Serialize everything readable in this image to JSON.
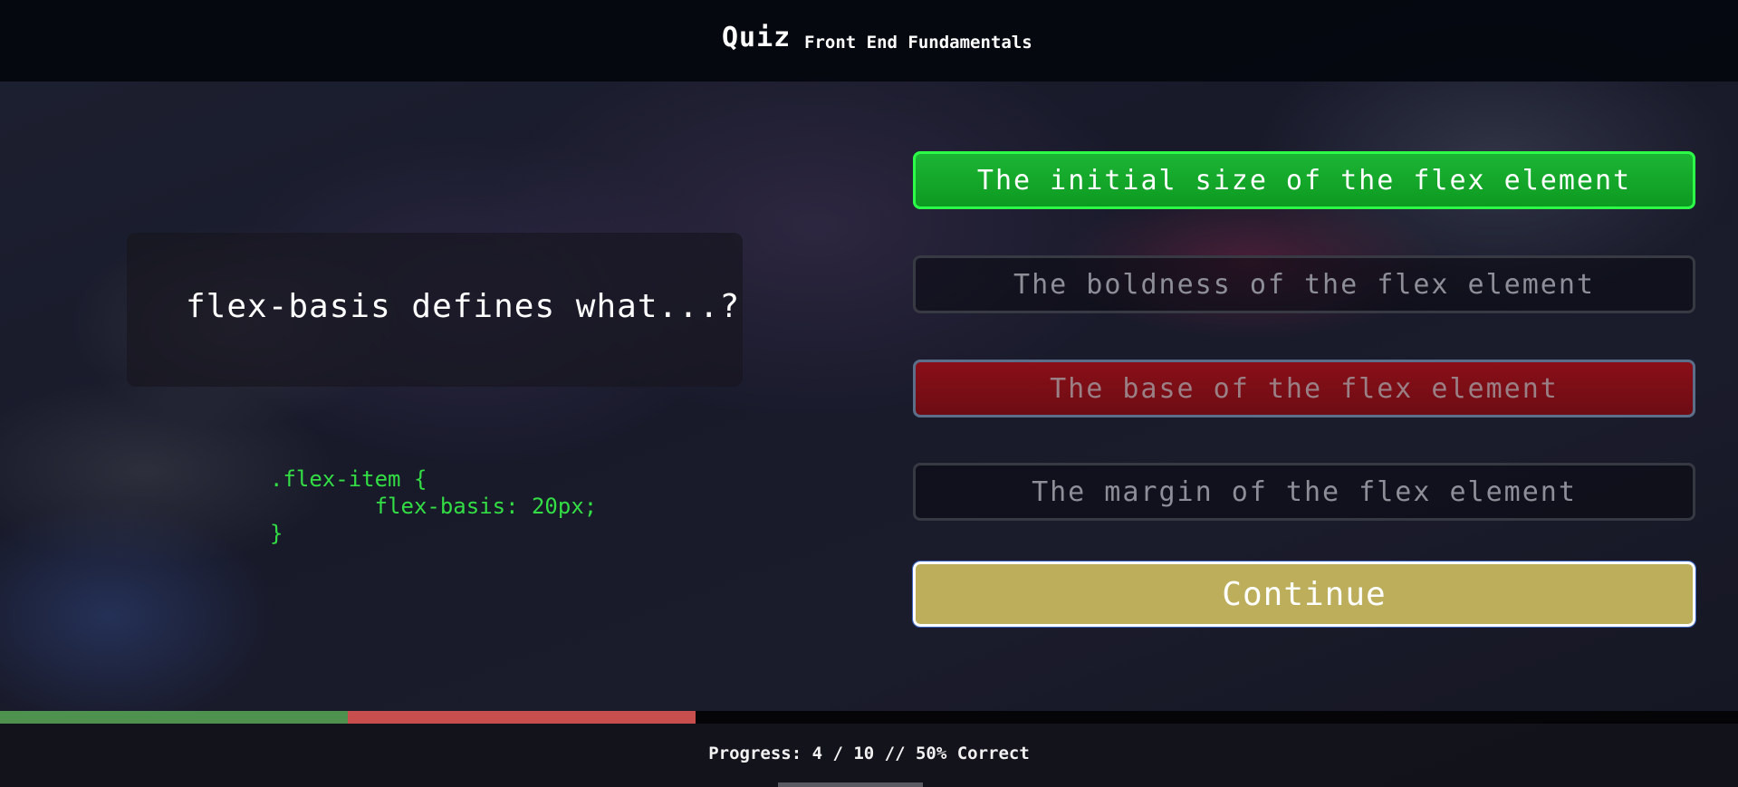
{
  "header": {
    "brand": "Quiz",
    "subtitle": "Front End Fundamentals"
  },
  "question": {
    "text": "flex-basis defines what...?",
    "code_lines": [
      ".flex-item {",
      "        flex-basis: 20px;",
      "}"
    ]
  },
  "answers": [
    {
      "label": "The initial size of the flex element",
      "state": "correct"
    },
    {
      "label": "The boldness of the flex element",
      "state": "unselected"
    },
    {
      "label": "The base of the flex element",
      "state": "wrong-selected"
    },
    {
      "label": "The margin of the flex element",
      "state": "unselected"
    }
  ],
  "continue_label": "Continue",
  "progress": {
    "text": "Progress: 4 / 10 // 50% Correct",
    "correct_fraction": 0.2,
    "wrong_fraction": 0.2
  },
  "colors": {
    "correct": "#1cb534",
    "wrong": "#8a0f18",
    "continue": "#bdae5c",
    "code": "#33dd44",
    "bar_correct": "#4f914f",
    "bar_wrong": "#c94f4f"
  }
}
